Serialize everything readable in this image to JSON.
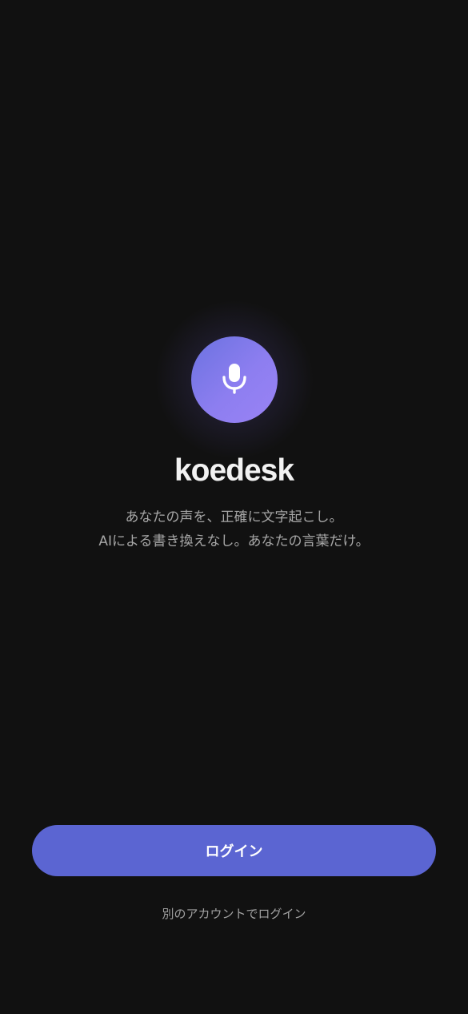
{
  "app": {
    "name": "koedesk",
    "tagline_line1": "あなたの声を、正確に文字起こし。",
    "tagline_line2": "AIによる書き換えなし。あなたの言葉だけ。",
    "logo_icon": "microphone-icon"
  },
  "actions": {
    "login_label": "ログイン",
    "alt_login_label": "別のアカウントでログイン"
  },
  "colors": {
    "background": "#111111",
    "accent": "#5b65d2",
    "logo_gradient_start": "#6b72e0",
    "logo_gradient_end": "#9a83f5",
    "title_text": "#f2f2f2",
    "secondary_text": "#a6a6a6"
  }
}
